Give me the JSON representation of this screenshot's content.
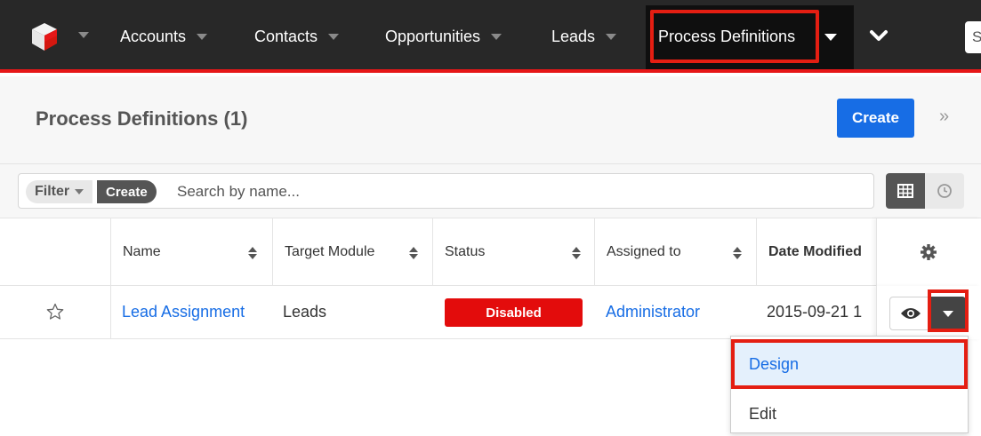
{
  "nav": {
    "items": [
      {
        "label": "Accounts"
      },
      {
        "label": "Contacts"
      },
      {
        "label": "Opportunities"
      },
      {
        "label": "Leads"
      }
    ],
    "active": {
      "label": "Process Definitions"
    },
    "search_peek": "S"
  },
  "header": {
    "title": "Process Definitions (1)",
    "create_label": "Create",
    "collapse_glyph": "»"
  },
  "filter": {
    "filter_label": "Filter",
    "create_label": "Create",
    "search_placeholder": "Search by name..."
  },
  "table": {
    "columns": [
      "Name",
      "Target Module",
      "Status",
      "Assigned to",
      "Date Modified"
    ],
    "rows": [
      {
        "name": "Lead Assignment",
        "target_module": "Leads",
        "status": "Disabled",
        "assigned_to": "Administrator",
        "date_modified": "2015-09-21 1"
      }
    ]
  },
  "row_menu": {
    "items": [
      {
        "label": "Design"
      },
      {
        "label": "Edit"
      }
    ]
  },
  "colors": {
    "nav_bg": "#282828",
    "nav_accent": "#e61718",
    "primary": "#176de5",
    "status_disabled": "#e30c0c",
    "annotation_highlight": "#e41e12"
  }
}
